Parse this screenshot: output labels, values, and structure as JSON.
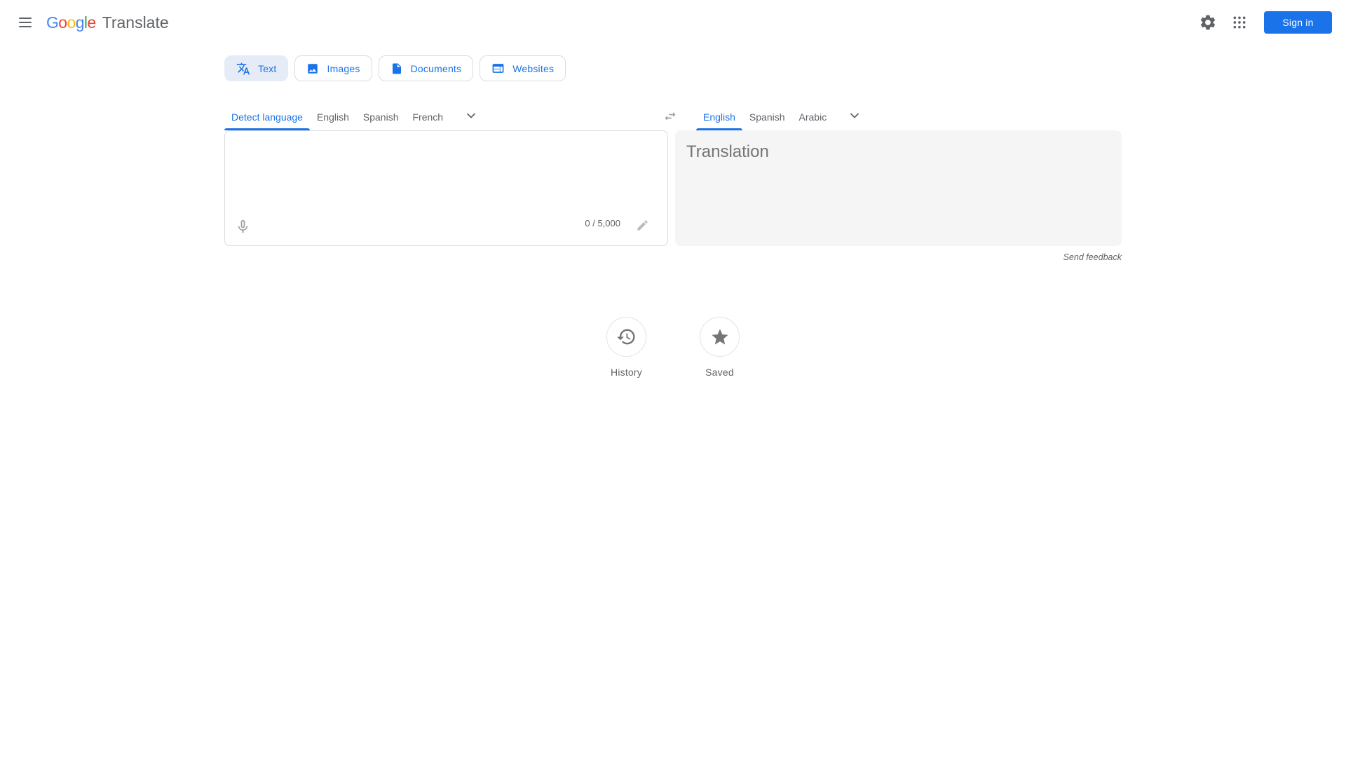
{
  "header": {
    "logo_letters": [
      {
        "ch": "G",
        "color": "#4285F4"
      },
      {
        "ch": "o",
        "color": "#EA4335"
      },
      {
        "ch": "o",
        "color": "#FBBC05"
      },
      {
        "ch": "g",
        "color": "#4285F4"
      },
      {
        "ch": "l",
        "color": "#34A853"
      },
      {
        "ch": "e",
        "color": "#EA4335"
      }
    ],
    "product_name": "Translate",
    "signin_label": "Sign in"
  },
  "mode_tabs": [
    {
      "label": "Text",
      "icon": "translate-icon",
      "selected": true
    },
    {
      "label": "Images",
      "icon": "image-icon",
      "selected": false
    },
    {
      "label": "Documents",
      "icon": "document-icon",
      "selected": false
    },
    {
      "label": "Websites",
      "icon": "website-icon",
      "selected": false
    }
  ],
  "source_language_tabs": {
    "selected": "Detect language",
    "tabs": [
      "Detect language",
      "English",
      "Spanish",
      "French"
    ]
  },
  "target_language_tabs": {
    "selected": "English",
    "tabs": [
      "English",
      "Spanish",
      "Arabic"
    ]
  },
  "source_panel": {
    "text": "",
    "char_counter": "0 / 5,000"
  },
  "target_panel": {
    "placeholder": "Translation"
  },
  "send_feedback_label": "Send feedback",
  "shortcuts": [
    {
      "label": "History",
      "icon": "history-icon"
    },
    {
      "label": "Saved",
      "icon": "star-icon"
    }
  ],
  "colors": {
    "accent_blue": "#1a73e8",
    "selected_chip_bg": "#e6ecf7",
    "border_gray": "#dadce0",
    "output_panel_bg": "#f5f5f5",
    "text_gray": "#5f6368",
    "placeholder_gray": "#757575",
    "disabled_icon_gray": "#9aa0a6"
  }
}
